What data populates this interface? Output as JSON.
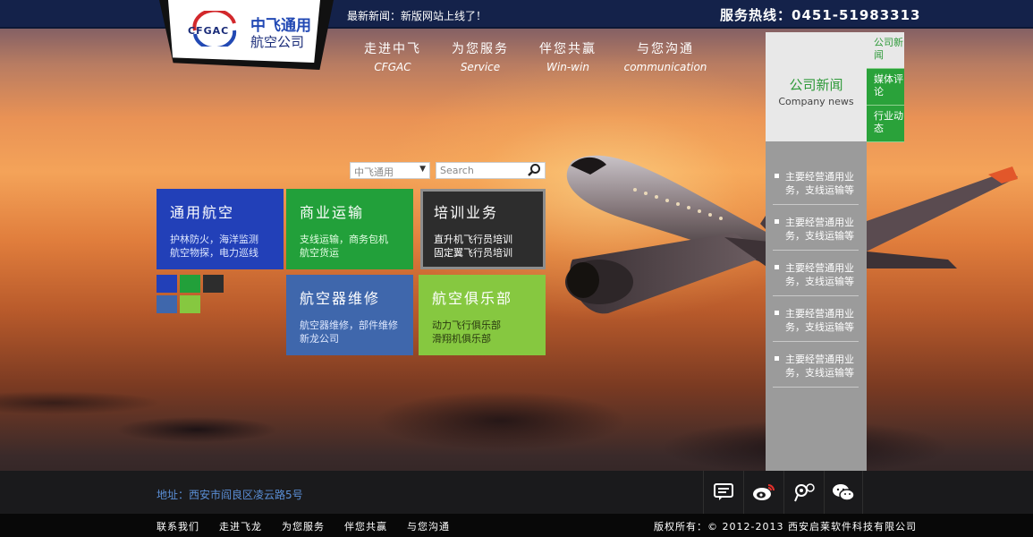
{
  "topbar": {
    "news": "最新新闻：新版网站上线了！",
    "hotline": "服务热线：0451-51983313"
  },
  "logo": {
    "abbr": "CFGAC",
    "name_line1": "中飞通用",
    "name_line2": "航空公司"
  },
  "nav": [
    {
      "zh": "走进中飞",
      "en": "CFGAC"
    },
    {
      "zh": "为您服务",
      "en": "Service"
    },
    {
      "zh": "伴您共赢",
      "en": "Win-win"
    },
    {
      "zh": "与您沟通",
      "en": "communication"
    }
  ],
  "search": {
    "select_value": "中飞通用",
    "placeholder": "Search"
  },
  "tiles": [
    {
      "title": "通用航空",
      "line1": "护林防火，海洋监测",
      "line2": "航空物探，电力巡线"
    },
    {
      "title": "商业运输",
      "line1": "支线运输，商务包机",
      "line2": "航空货运"
    },
    {
      "title": "培训业务",
      "line1": "直升机飞行员培训",
      "line2": "固定翼飞行员培训"
    },
    {
      "title": "航空器维修",
      "line1": "航空器维修，部件维修",
      "line2": "新龙公司"
    },
    {
      "title": "航空俱乐部",
      "line1": "动力飞行俱乐部",
      "line2": "滑翔机俱乐部"
    }
  ],
  "swatches": [
    "#2240b8",
    "#22a03a",
    "#2d2d2d",
    "#3f67ac",
    "#86c840"
  ],
  "right_panel": {
    "title_zh": "公司新闻",
    "title_en": "Company news",
    "items": [
      "主要经营通用业务，支线运输等",
      "主要经营通用业务，支线运输等",
      "主要经营通用业务，支线运输等",
      "主要经营通用业务，支线运输等",
      "主要经营通用业务，支线运输等"
    ],
    "tabs": [
      "公司新闻",
      "媒体评论",
      "行业动态"
    ]
  },
  "footer": {
    "address": "地址：西安市阎良区凌云路5号",
    "links": [
      "联系我们",
      "走进飞龙",
      "为您服务",
      "伴您共赢",
      "与您沟通"
    ],
    "copyright": "版权所有：© 2012-2013 西安启莱软件科技有限公司"
  },
  "social": [
    "chat-icon",
    "weibo-icon",
    "tencent-weibo-icon",
    "wechat-icon"
  ]
}
